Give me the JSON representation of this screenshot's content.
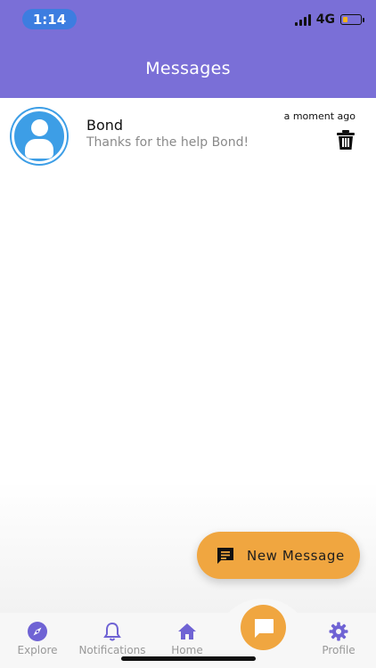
{
  "status_bar": {
    "time": "1:14",
    "network": "4G"
  },
  "header": {
    "title": "Messages"
  },
  "messages": [
    {
      "sender": "Bond",
      "preview": "Thanks for the help Bond!",
      "timestamp": "a moment ago"
    }
  ],
  "new_message_button": {
    "label": "New Message"
  },
  "tabs": [
    {
      "label": "Explore",
      "icon": "compass-icon"
    },
    {
      "label": "Notifications",
      "icon": "bell-icon"
    },
    {
      "label": "Home",
      "icon": "home-icon"
    },
    {
      "label": "Profile",
      "icon": "gear-icon"
    }
  ],
  "center_tab": {
    "icon": "chat-icon"
  },
  "colors": {
    "header": "#7a6fd7",
    "accent": "#f0a640",
    "avatar": "#3d9ee6",
    "time_pill": "#3d7de0",
    "tab_icon": "#6f63d4"
  }
}
